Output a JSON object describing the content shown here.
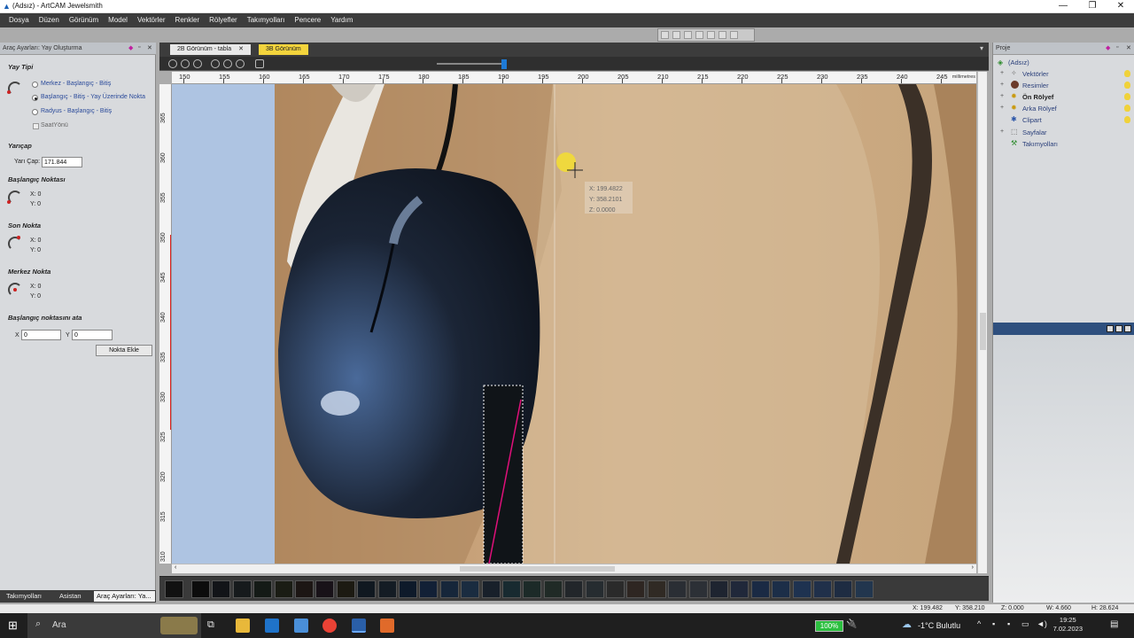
{
  "window": {
    "title": "(Adsız) - ArtCAM Jewelsmith",
    "minimize": "—",
    "maximize": "❐",
    "close": "✕"
  },
  "menu": [
    "Dosya",
    "Düzen",
    "Görünüm",
    "Model",
    "Vektörler",
    "Renkler",
    "Rölyefler",
    "Takımyolları",
    "Pencere",
    "Yardım"
  ],
  "left_panel": {
    "title": "Araç Ayarları: Yay Oluşturma",
    "arc_type_title": "Yay Tipi",
    "arc_options": [
      {
        "label": "Merkez - Başlangıç - Bitiş",
        "selected": false
      },
      {
        "label": "Başlangıç - Bitiş - Yay Üzerinde Nokta",
        "selected": true
      },
      {
        "label": "Radyus - Başlangıç - Bitiş",
        "selected": false
      }
    ],
    "clockwise_label": "SaatYönü",
    "radius_title": "Yarıçap",
    "radius_label": "Yarı Çap:",
    "radius_value": "171.844",
    "start_title": "Başlangıç Noktası",
    "start_x": "X: 0",
    "start_y": "Y: 0",
    "end_title": "Son Nokta",
    "end_x": "X: 0",
    "end_y": "Y: 0",
    "center_title": "Merkez Nokta",
    "center_x": "X: 0",
    "center_y": "Y: 0",
    "set_start_title": "Başlangıç noktasını ata",
    "x_label": "X",
    "x_value": "0",
    "y_label": "Y",
    "y_value": "0",
    "add_point_button": "Nokta Ekle",
    "tabs": [
      "Takımyolları",
      "Asistan",
      "Araç Ayarları: Ya..."
    ]
  },
  "doc_tabs": [
    {
      "label": "2B Görünüm - tabla",
      "active": true
    },
    {
      "label": "3B Görünüm",
      "active": false
    }
  ],
  "ruler": {
    "h_ticks": [
      "150",
      "155",
      "160",
      "165",
      "170",
      "175",
      "180",
      "185",
      "190",
      "195",
      "200",
      "205",
      "210",
      "215",
      "220",
      "225",
      "230",
      "235",
      "240",
      "245"
    ],
    "units": "millimetres",
    "v_ticks": [
      "365",
      "360",
      "355",
      "350",
      "345",
      "340",
      "335",
      "330",
      "325",
      "320",
      "315",
      "310"
    ]
  },
  "cursor_readout": {
    "x": "X: 199.4822",
    "y": "Y: 358.2101",
    "z": "Z: 0.0000"
  },
  "right_panel": {
    "title": "Proje",
    "tree": [
      {
        "label": "(Adsız)",
        "bold": false
      },
      {
        "label": "Vektörler",
        "bold": false
      },
      {
        "label": "Resimler",
        "bold": false
      },
      {
        "label": "Ön Rölyef",
        "bold": true
      },
      {
        "label": "Arka Rölyef",
        "bold": false
      },
      {
        "label": "Clipart",
        "bold": false
      },
      {
        "label": "Sayfalar",
        "bold": false
      },
      {
        "label": "Takımyolları",
        "bold": false
      }
    ]
  },
  "status": {
    "x": "X: 199.482",
    "y": "Y: 358.210",
    "z": "Z: 0.000",
    "w": "W: 4.660",
    "h": "H: 28.624"
  },
  "taskbar": {
    "search_placeholder": "Ara",
    "battery": "100%",
    "weather": "-1°C  Bulutlu",
    "time": "19:25",
    "date": "7.02.2023"
  },
  "colors": {
    "accent": "#1e7ad6",
    "menu_bg": "#3c3c3c",
    "panel_bg": "#d8dadd",
    "selection_magenta": "#e0107a"
  }
}
